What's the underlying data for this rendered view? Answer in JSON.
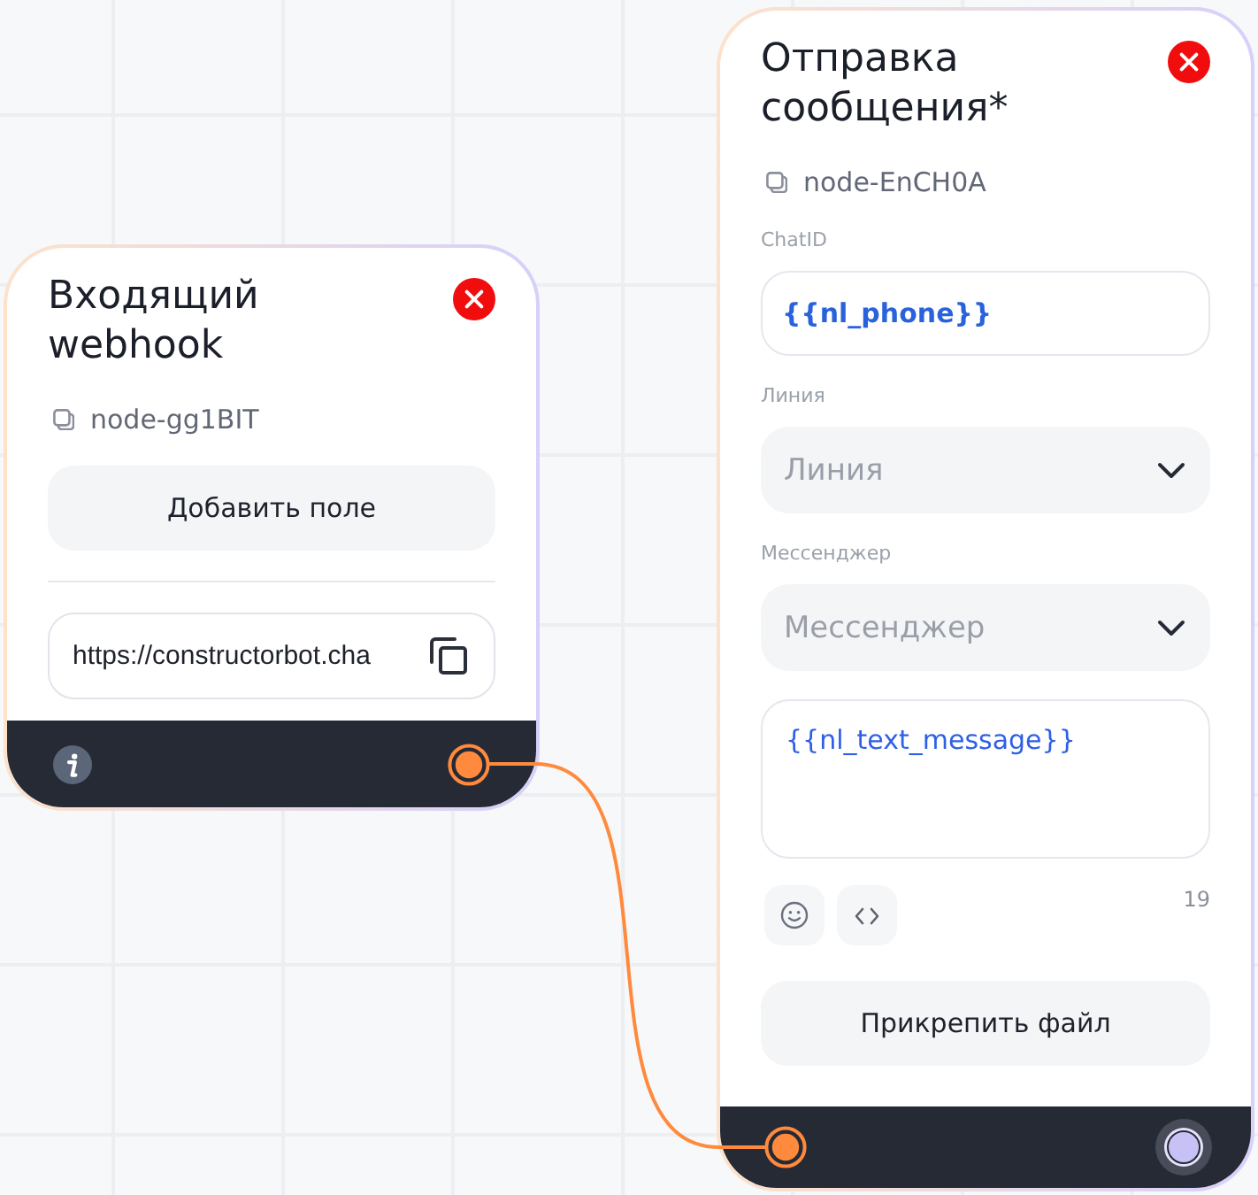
{
  "nodes": [
    {
      "kind": "webhook",
      "title": "Входящий webhook",
      "node_id": "node-gg1BIT",
      "add_field_button": "Добавить поле",
      "url": "https://constructorbot.cha",
      "info": true,
      "output_port": {
        "connected": true
      }
    },
    {
      "kind": "message",
      "title": "Отправка сообщения*",
      "node_id": "node-EnCH0A",
      "fields": [
        {
          "kind": "input",
          "label": "ChatID",
          "value": "{{nl_phone}}"
        },
        {
          "kind": "select",
          "label": "Линия",
          "placeholder": "Линия"
        },
        {
          "kind": "select",
          "label": "Мессенджер",
          "placeholder": "Мессенджер"
        },
        {
          "kind": "textarea",
          "value": "{{nl_text_message}}"
        }
      ],
      "char_count": "19",
      "attach_button": "Прикрепить файл",
      "input_port": {
        "connected": true
      },
      "output_port": {
        "connected": false
      }
    }
  ]
}
